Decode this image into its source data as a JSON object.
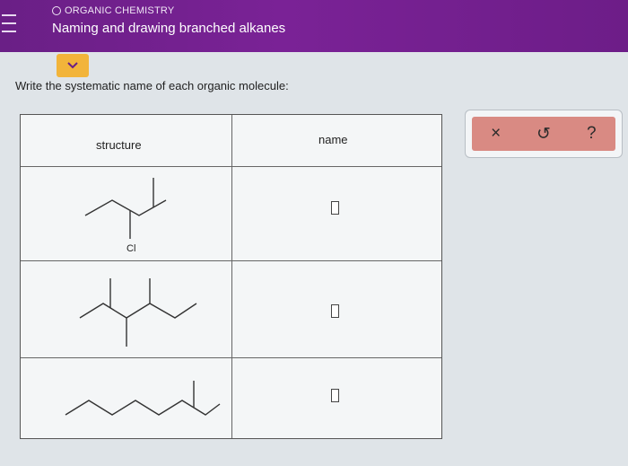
{
  "header": {
    "subject": "ORGANIC CHEMISTRY",
    "title": "Naming and drawing branched alkanes"
  },
  "prompt": "Write the systematic name of each organic molecule:",
  "table": {
    "col_structure": "structure",
    "col_name": "name",
    "rows": [
      {
        "substituent_label": "Cl",
        "answer": ""
      },
      {
        "answer": ""
      },
      {
        "answer": ""
      }
    ]
  },
  "toolbar": {
    "close": "×",
    "undo": "↺",
    "help": "?"
  },
  "icons": {
    "menu": "hamburger-icon",
    "expand": "chevron-down-icon",
    "subject": "ring-icon"
  },
  "colors": {
    "header_bg": "#7a2296",
    "chevron_btn": "#f2b43a",
    "toolbar_bg": "#d98a83"
  }
}
